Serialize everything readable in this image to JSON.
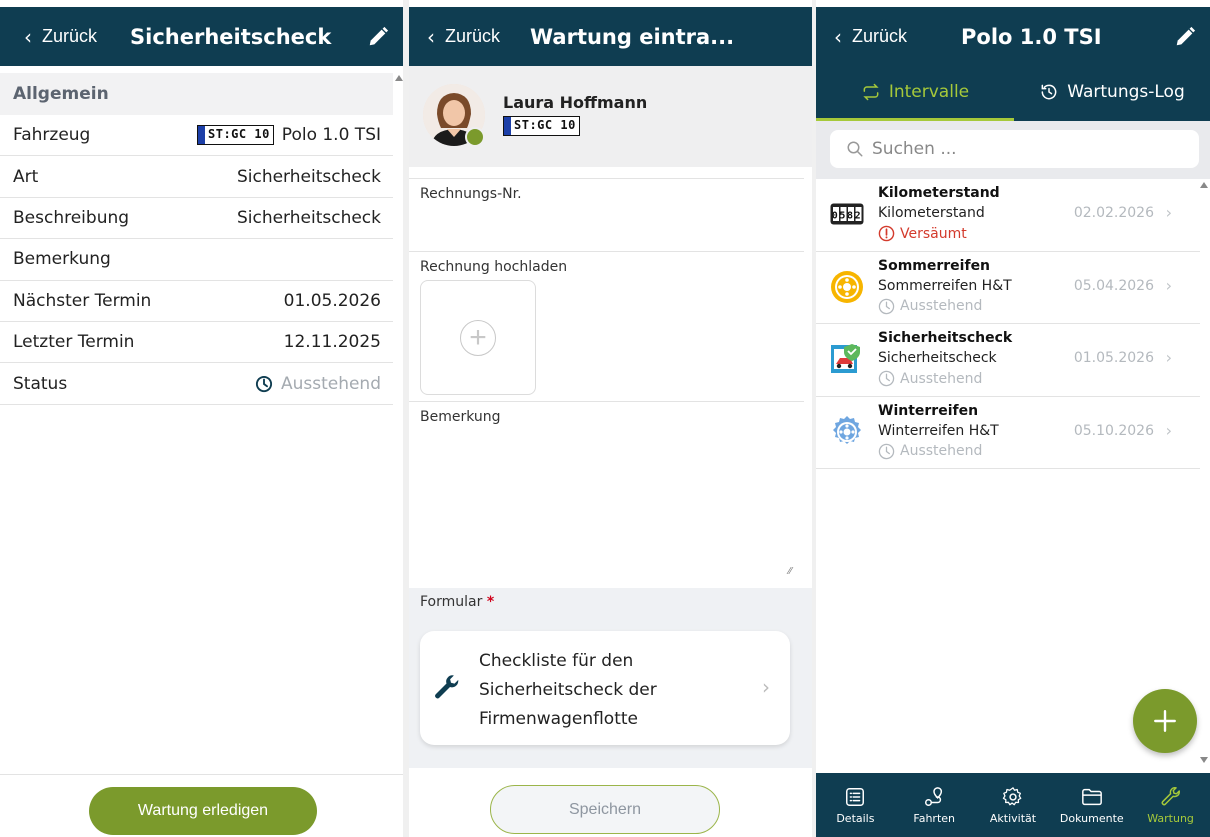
{
  "colors": {
    "header": "#0f3d51",
    "accent": "#7b9a2c",
    "tab_active": "#a6c93a",
    "missed": "#d33a2c",
    "pending": "#b4b9be"
  },
  "panel1": {
    "back_label": "Zurück",
    "title": "Sicherheitscheck",
    "section": "Allgemein",
    "rows": [
      {
        "label": "Fahrzeug",
        "plate": "ST:GC 10",
        "value": "Polo 1.0 TSI"
      },
      {
        "label": "Art",
        "value": "Sicherheitscheck"
      },
      {
        "label": "Beschreibung",
        "value": "Sicherheitscheck"
      },
      {
        "label": "Bemerkung",
        "value": ""
      },
      {
        "label": "Nächster Termin",
        "value": "01.05.2026"
      },
      {
        "label": "Letzter Termin",
        "value": "12.11.2025"
      },
      {
        "label": "Status",
        "value": "Ausstehend",
        "icon": "clock-icon"
      }
    ],
    "complete_button": "Wartung erledigen"
  },
  "panel2": {
    "back_label": "Zurück",
    "title": "Wartung eintra...",
    "person_name": "Laura Hoffmann",
    "plate": "ST:GC 10",
    "invoice_no_label": "Rechnungs-Nr.",
    "invoice_upload_label": "Rechnung hochladen",
    "remark_label": "Bemerkung",
    "form_label": "Formular",
    "form_required_mark": "*",
    "form_card_text": "Checkliste für den Sicherheitscheck der Firmenwagenflotte",
    "save_button": "Speichern"
  },
  "panel3": {
    "back_label": "Zurück",
    "title": "Polo 1.0 TSI",
    "tabs": [
      {
        "label": "Intervalle",
        "icon": "repeat-icon",
        "active": true
      },
      {
        "label": "Wartungs-Log",
        "icon": "history-icon",
        "active": false
      }
    ],
    "search_placeholder": "Suchen ...",
    "items": [
      {
        "title": "Kilometerstand",
        "subtitle": "Kilometerstand",
        "status": "Versäumt",
        "status_type": "missed",
        "date": "02.02.2026",
        "icon": "odometer-icon",
        "odometer": "0582"
      },
      {
        "title": "Sommerreifen",
        "subtitle": "Sommerreifen H&T",
        "status": "Ausstehend",
        "status_type": "pending",
        "date": "05.04.2026",
        "icon": "summer-tire-icon"
      },
      {
        "title": "Sicherheitscheck",
        "subtitle": "Sicherheitscheck",
        "status": "Ausstehend",
        "status_type": "pending",
        "date": "01.05.2026",
        "icon": "safety-check-icon"
      },
      {
        "title": "Winterreifen",
        "subtitle": "Winterreifen H&T",
        "status": "Ausstehend",
        "status_type": "pending",
        "date": "05.10.2026",
        "icon": "winter-tire-icon"
      }
    ],
    "nav": [
      {
        "label": "Details",
        "icon": "details-icon",
        "active": false
      },
      {
        "label": "Fahrten",
        "icon": "route-icon",
        "active": false
      },
      {
        "label": "Aktivität",
        "icon": "gear-icon",
        "active": false
      },
      {
        "label": "Dokumente",
        "icon": "folder-icon",
        "active": false
      },
      {
        "label": "Wartung",
        "icon": "wrench-icon",
        "active": true
      }
    ]
  }
}
